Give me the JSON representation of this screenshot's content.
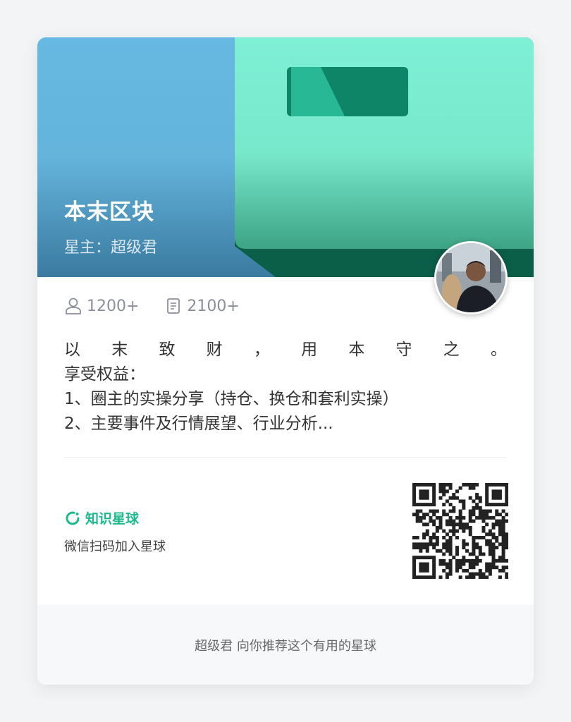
{
  "banner": {
    "title": "本末区块",
    "owner": "星主：超级君",
    "left_color": "#66b9e2",
    "right_color": "#7ef0d5",
    "tag_color": "#0f8568"
  },
  "stats": {
    "members": "1200+",
    "posts": "2100+",
    "members_icon": "user-icon",
    "posts_icon": "document-icon"
  },
  "description": {
    "motto_chars": [
      "以",
      "末",
      "致",
      "财",
      "，",
      "用",
      "本",
      "守",
      "之",
      "。"
    ],
    "lines": [
      "享受权益：",
      "1、圈主的实操分享（持仓、换仓和套利实操）",
      "2、主要事件及行情展望、行业分析..."
    ]
  },
  "footer": {
    "brand": "知识星球",
    "brand_icon": "zsxq-logo-icon",
    "brand_color": "#1cb88e",
    "join_text": "微信扫码加入星球",
    "qr_icon": "qr-code-icon"
  },
  "bottom": {
    "recommend_text": "超级君 向你推荐这个有用的星球"
  }
}
